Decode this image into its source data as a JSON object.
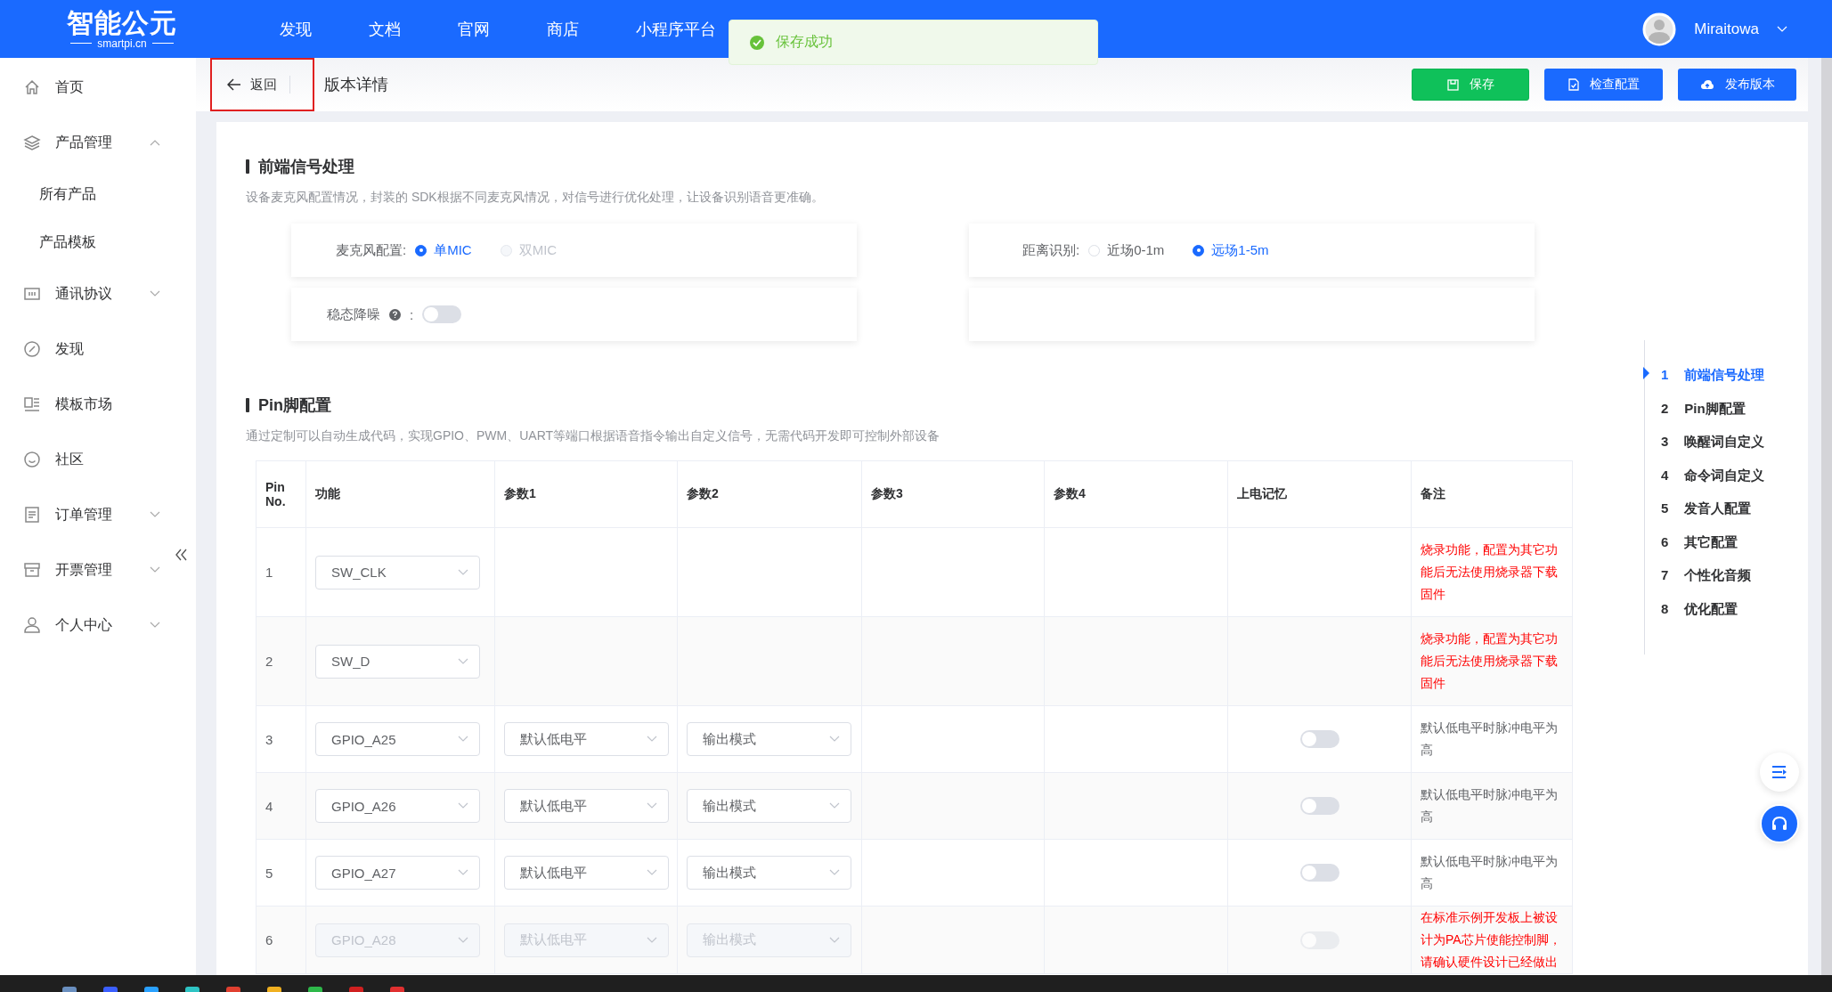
{
  "topbar": {
    "logo": {
      "name": "智能公元",
      "domain": "smartpi.cn"
    },
    "nav": [
      {
        "label": "发现"
      },
      {
        "label": "文档"
      },
      {
        "label": "官网"
      },
      {
        "label": "商店"
      },
      {
        "label": "小程序平台"
      }
    ],
    "user": {
      "name": "Miraitowa"
    }
  },
  "toast": {
    "message": "保存成功"
  },
  "sidebar": {
    "items": [
      {
        "label": "首页"
      },
      {
        "label": "产品管理",
        "expanded": true,
        "children": [
          {
            "label": "所有产品"
          },
          {
            "label": "产品模板"
          }
        ]
      },
      {
        "label": "通讯协议",
        "expanded": false
      },
      {
        "label": "发现"
      },
      {
        "label": "模板市场"
      },
      {
        "label": "社区"
      },
      {
        "label": "订单管理",
        "expanded": false
      },
      {
        "label": "开票管理",
        "expanded": false
      },
      {
        "label": "个人中心",
        "expanded": false
      }
    ]
  },
  "header": {
    "back": {
      "label": "返回",
      "highlighted": true
    },
    "title": "版本详情",
    "buttons": [
      {
        "label": "保存",
        "kind": "save"
      },
      {
        "label": "检查配置",
        "kind": "check"
      },
      {
        "label": "发布版本",
        "kind": "publish"
      }
    ]
  },
  "signal_section": {
    "title": "前端信号处理",
    "description": "设备麦克风配置情况，封装的 SDK根据不同麦克风情况，对信号进行优化处理，让设备识别语音更准确。",
    "mic": {
      "label": "麦克风配置:",
      "options": [
        {
          "label": "单MIC",
          "selected": true,
          "disabled": false
        },
        {
          "label": "双MIC",
          "selected": false,
          "disabled": true
        }
      ]
    },
    "distance": {
      "label": "距离识别:",
      "options": [
        {
          "label": "近场0-1m",
          "selected": false,
          "disabled": false
        },
        {
          "label": "远场1-5m",
          "selected": true,
          "disabled": false
        }
      ]
    },
    "noise": {
      "label": "稳态降噪",
      "separator": ":",
      "on": false
    }
  },
  "pin_section": {
    "title": "Pin脚配置",
    "description": "通过定制可以自动生成代码，实现GPIO、PWM、UART等端口根据语音指令输出自定义信号，无需代码开发即可控制外部设备",
    "table": {
      "columns": [
        "Pin No.",
        "功能",
        "参数1",
        "参数2",
        "参数3",
        "参数4",
        "上电记忆",
        "备注"
      ],
      "rows": [
        {
          "pin": "1",
          "function": "SW_CLK",
          "note": "烧录功能，配置为其它功能后无法使用烧录器下载固件",
          "alert": true,
          "disabled": false
        },
        {
          "pin": "2",
          "function": "SW_D",
          "note": "烧录功能，配置为其它功能后无法使用烧录器下载固件",
          "alert": true,
          "disabled": false
        },
        {
          "pin": "3",
          "function": "GPIO_A25",
          "param1": "默认低电平",
          "param2": "输出模式",
          "memory": false,
          "note": "默认低电平时脉冲电平为高",
          "alert": false,
          "disabled": false
        },
        {
          "pin": "4",
          "function": "GPIO_A26",
          "param1": "默认低电平",
          "param2": "输出模式",
          "memory": false,
          "note": "默认低电平时脉冲电平为高",
          "alert": false,
          "disabled": false
        },
        {
          "pin": "5",
          "function": "GPIO_A27",
          "param1": "默认低电平",
          "param2": "输出模式",
          "memory": false,
          "note": "默认低电平时脉冲电平为高",
          "alert": false,
          "disabled": false
        },
        {
          "pin": "6",
          "function": "GPIO_A28",
          "param1": "默认低电平",
          "param2": "输出模式",
          "memory": false,
          "note": "在标准示例开发板上被设计为PA芯片使能控制脚，请确认硬件设计已经做出",
          "alert": true,
          "disabled": true
        }
      ]
    }
  },
  "anchor_nav": {
    "items": [
      {
        "number": "1",
        "label": "前端信号处理",
        "selected": true
      },
      {
        "number": "2",
        "label": "Pin脚配置",
        "selected": false
      },
      {
        "number": "3",
        "label": "唤醒词自定义",
        "selected": false
      },
      {
        "number": "4",
        "label": "命令词自定义",
        "selected": false
      },
      {
        "number": "5",
        "label": "发音人配置",
        "selected": false
      },
      {
        "number": "6",
        "label": "其它配置",
        "selected": false
      },
      {
        "number": "7",
        "label": "个性化音频",
        "selected": false
      },
      {
        "number": "8",
        "label": "优化配置",
        "selected": false
      }
    ]
  }
}
